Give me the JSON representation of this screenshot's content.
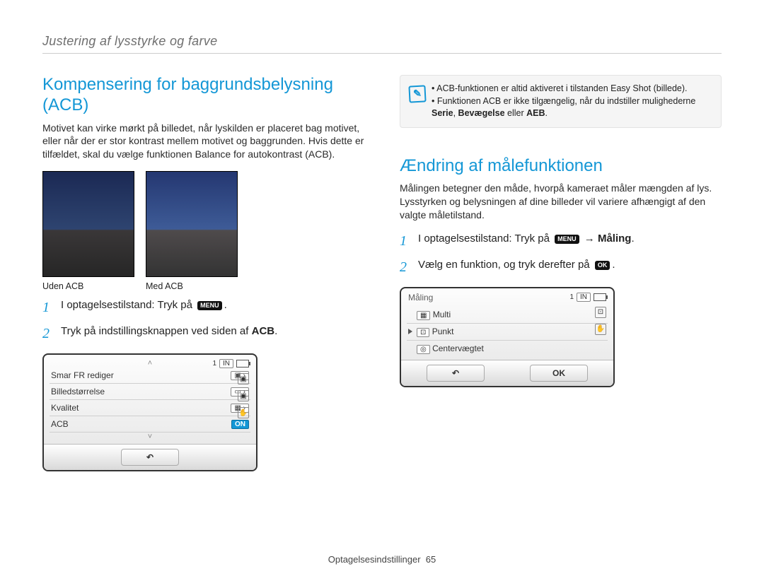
{
  "breadcrumb": "Justering af lysstyrke og farve",
  "left": {
    "heading": "Kompensering for baggrundsbelysning (ACB)",
    "body": "Motivet kan virke mørkt på billedet, når lyskilden er placeret bag motivet, eller når der er stor kontrast mellem motivet og baggrunden. Hvis dette er tilfældet, skal du vælge funktionen Balance for autokontrast (ACB).",
    "caption_a": "Uden ACB",
    "caption_b": "Med ACB",
    "step1": "I optagelsestilstand: Tryk på",
    "step1_kbd": "MENU",
    "step1_tail": ".",
    "step2_a": "Tryk på indstillingsknappen ved siden af ",
    "step2_b": "ACB",
    "step2_tail": ".",
    "lcd": {
      "status_num": "1",
      "status_in": "IN",
      "rows": [
        {
          "label": "Smar FR rediger",
          "right": "icon-arrow"
        },
        {
          "label": "Billedstørrelse",
          "right": "icon-arrow"
        },
        {
          "label": "Kvalitet",
          "right": "icon-arrow"
        },
        {
          "label": "ACB",
          "right": "on"
        }
      ],
      "back": "↶"
    }
  },
  "note": {
    "line1": "ACB-funktionen er altid aktiveret i tilstanden Easy Shot (billede).",
    "line2_a": "Funktionen ACB er ikke tilgængelig, når du indstiller mulighederne ",
    "line2_b": "Serie",
    "line2_c": ", ",
    "line2_d": "Bevægelse",
    "line2_e": " eller ",
    "line2_f": "AEB",
    "line2_g": "."
  },
  "right": {
    "heading": "Ændring af målefunktionen",
    "body": "Målingen betegner den måde, hvorpå kameraet måler mængden af lys. Lysstyrken og belysningen af dine billeder vil variere afhængigt af den valgte måletilstand.",
    "step1_a": "I optagelsestilstand: Tryk på ",
    "step1_kbd": "MENU",
    "step1_arrow": " → ",
    "step1_b": "Måling",
    "step1_tail": ".",
    "step2_a": "Vælg en funktion, og tryk derefter på ",
    "step2_kbd": "OK",
    "step2_tail": ".",
    "lcd": {
      "title": "Måling",
      "status_num": "1",
      "status_in": "IN",
      "rows": [
        {
          "label": "Multi"
        },
        {
          "label": "Punkt",
          "selected": true
        },
        {
          "label": "Centervægtet"
        }
      ],
      "back": "↶",
      "ok": "OK"
    }
  },
  "footer_label": "Optagelsesindstillinger",
  "footer_page": "65"
}
